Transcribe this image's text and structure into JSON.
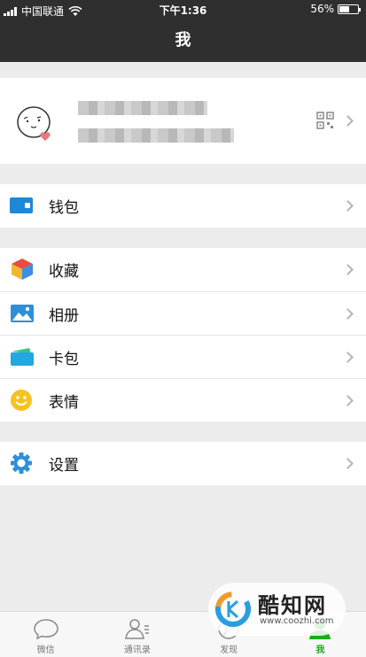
{
  "status_bar": {
    "carrier": "中国联通",
    "time": "下午1:36",
    "battery": "56%"
  },
  "header": {
    "title": "我"
  },
  "menu": {
    "wallet": "钱包",
    "favorites": "收藏",
    "album": "相册",
    "card_pack": "卡包",
    "stickers": "表情",
    "settings": "设置"
  },
  "tabbar": {
    "tabs": [
      {
        "label": "微信",
        "icon": "chat-bubble-icon"
      },
      {
        "label": "通讯录",
        "icon": "contacts-icon"
      },
      {
        "label": "发现",
        "icon": "compass-icon"
      },
      {
        "label": "我",
        "icon": "me-icon"
      }
    ]
  },
  "watermark": {
    "title": "酷知网",
    "url": "www.coozhi.com"
  },
  "colors": {
    "accent": "#1aad19",
    "header_bg": "#2f2f2f",
    "page_bg": "#ececec"
  }
}
